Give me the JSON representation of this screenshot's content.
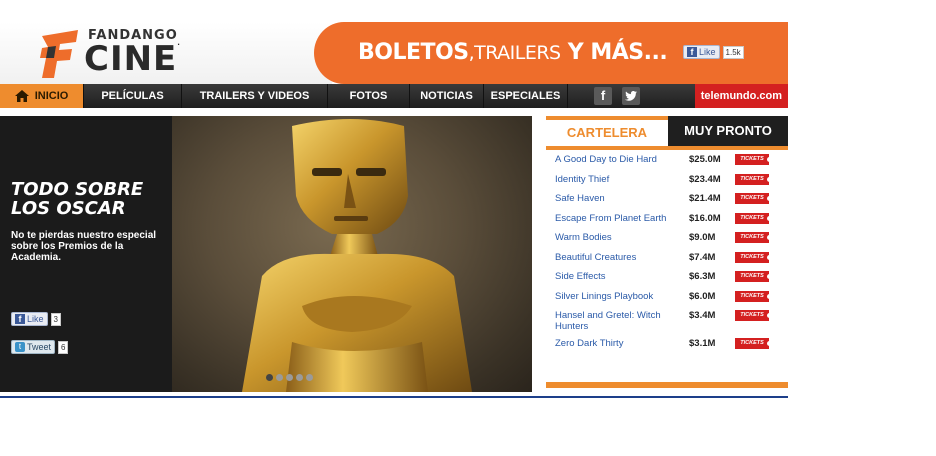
{
  "header": {
    "logo_top": "FANDANGO",
    "logo_main": "CINE",
    "logo_mark": ".",
    "banner_part1": "BOLETOS",
    "banner_part2": ",TRAILERS",
    "banner_part3": " Y ",
    "banner_part4": "MÁS...",
    "fb_like_label": "Like",
    "fb_like_count": "1.5k"
  },
  "nav": {
    "items": [
      "INICIO",
      "PELÍCULAS",
      "TRAILERS Y VIDEOS",
      "FOTOS",
      "NOTICIAS",
      "ESPECIALES"
    ],
    "social": [
      "f",
      "t"
    ],
    "partner": "telemundo.com"
  },
  "hero": {
    "title_line1": "TODO SOBRE",
    "title_line2": "LOS OSCAR",
    "description": "No te pierdas nuestro especial sobre los Premios de la Academia.",
    "like_label": "Like",
    "like_count": "3",
    "tweet_label": "Tweet",
    "tweet_count": "6",
    "slide_count": 5,
    "active_slide": 1
  },
  "sidebar": {
    "tabs": [
      "CARTELERA",
      "MUY PRONTO"
    ],
    "ticket_label": "TICKETS",
    "movies": [
      {
        "title": "A Good Day to Die Hard",
        "gross": "$25.0M"
      },
      {
        "title": "Identity Thief",
        "gross": "$23.4M"
      },
      {
        "title": "Safe Haven",
        "gross": "$21.4M"
      },
      {
        "title": "Escape From Planet Earth",
        "gross": "$16.0M"
      },
      {
        "title": "Warm Bodies",
        "gross": "$9.0M"
      },
      {
        "title": "Beautiful Creatures",
        "gross": "$7.4M"
      },
      {
        "title": "Side Effects",
        "gross": "$6.3M"
      },
      {
        "title": "Silver Linings Playbook",
        "gross": "$6.0M"
      },
      {
        "title": "Hansel and Gretel: Witch Hunters",
        "gross": "$3.4M"
      },
      {
        "title": "Zero Dark Thirty",
        "gross": "$3.1M"
      }
    ]
  },
  "colors": {
    "brand_orange": "#ee6d2b",
    "nav_dark": "#1f1f1f",
    "link_blue": "#2a5aa8",
    "ticket_red": "#d42020"
  }
}
